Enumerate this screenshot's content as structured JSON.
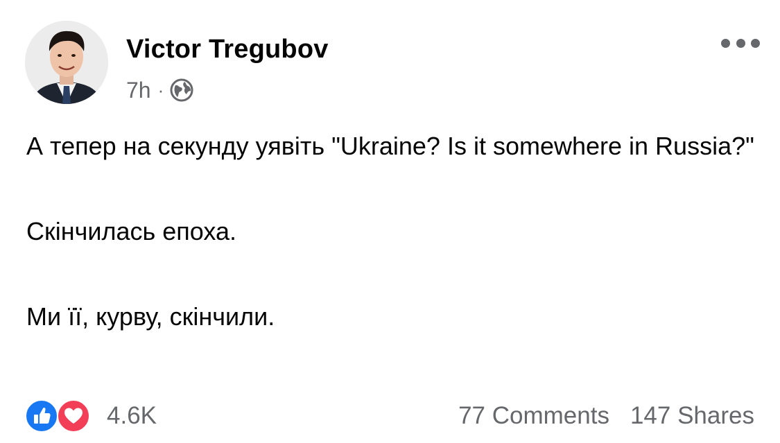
{
  "post": {
    "author": "Victor Tregubov",
    "timestamp": "7h",
    "separator": "·",
    "audience_icon": "globe-icon",
    "menu_icon": "more-horizontal-icon",
    "body": {
      "line_1": "А тепер на секунду уявіть \"Ukraine? Is it somewhere in Russia?\"",
      "line_2": "Скінчилась епоха.",
      "line_3": "Ми її, курву, скінчили."
    },
    "reactions": {
      "icons": [
        "like-icon",
        "love-icon"
      ],
      "count": "4.6K",
      "like_color": "#1877f2",
      "love_color": "#f33e58"
    },
    "comments": "77 Comments",
    "shares": "147 Shares"
  },
  "colors": {
    "text": "#050505",
    "secondary_text": "#65676b"
  }
}
